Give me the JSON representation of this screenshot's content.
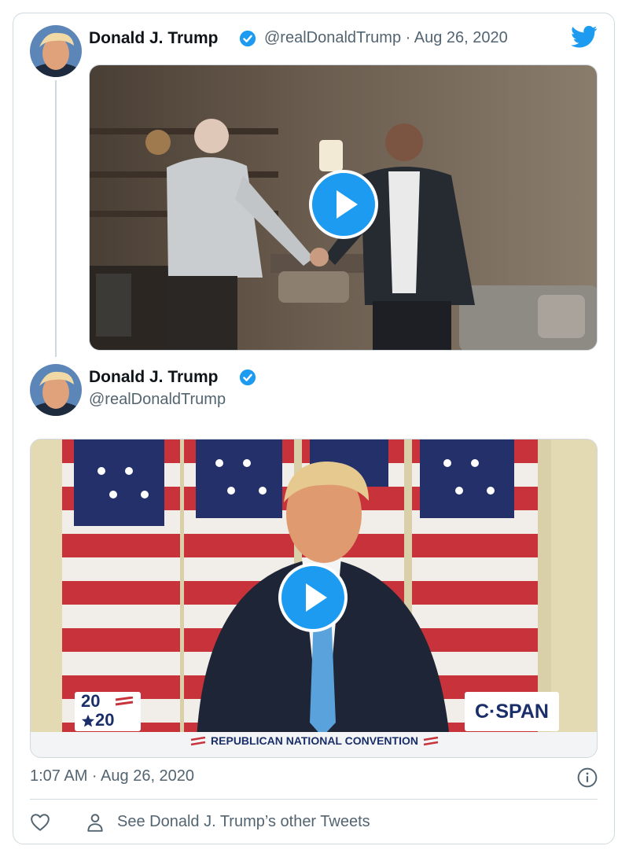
{
  "tweet1": {
    "author_name": "Donald J. Trump",
    "handle_date": "@realDonaldTrump · Aug 26, 2020"
  },
  "tweet2": {
    "author_name": "Donald J. Trump",
    "handle": "@realDonaldTrump"
  },
  "video2_overlay": {
    "year_top": "20",
    "year_bottom": "20",
    "network_logo": "C·SPAN",
    "banner": "REPUBLICAN NATIONAL CONVENTION"
  },
  "footer": {
    "timestamp": "1:07 AM · Aug 26, 2020",
    "other_tweets": "See Donald J. Trump’s other Tweets"
  },
  "icons": {
    "brand": "twitter-bird-icon",
    "verified": "verified-badge-icon",
    "play": "play-icon",
    "info": "info-icon",
    "like": "heart-icon",
    "profile": "person-icon"
  },
  "colors": {
    "accent": "#1d9bf0",
    "text_primary": "#0f1419",
    "text_secondary": "#536471",
    "border": "#cfd9de"
  }
}
